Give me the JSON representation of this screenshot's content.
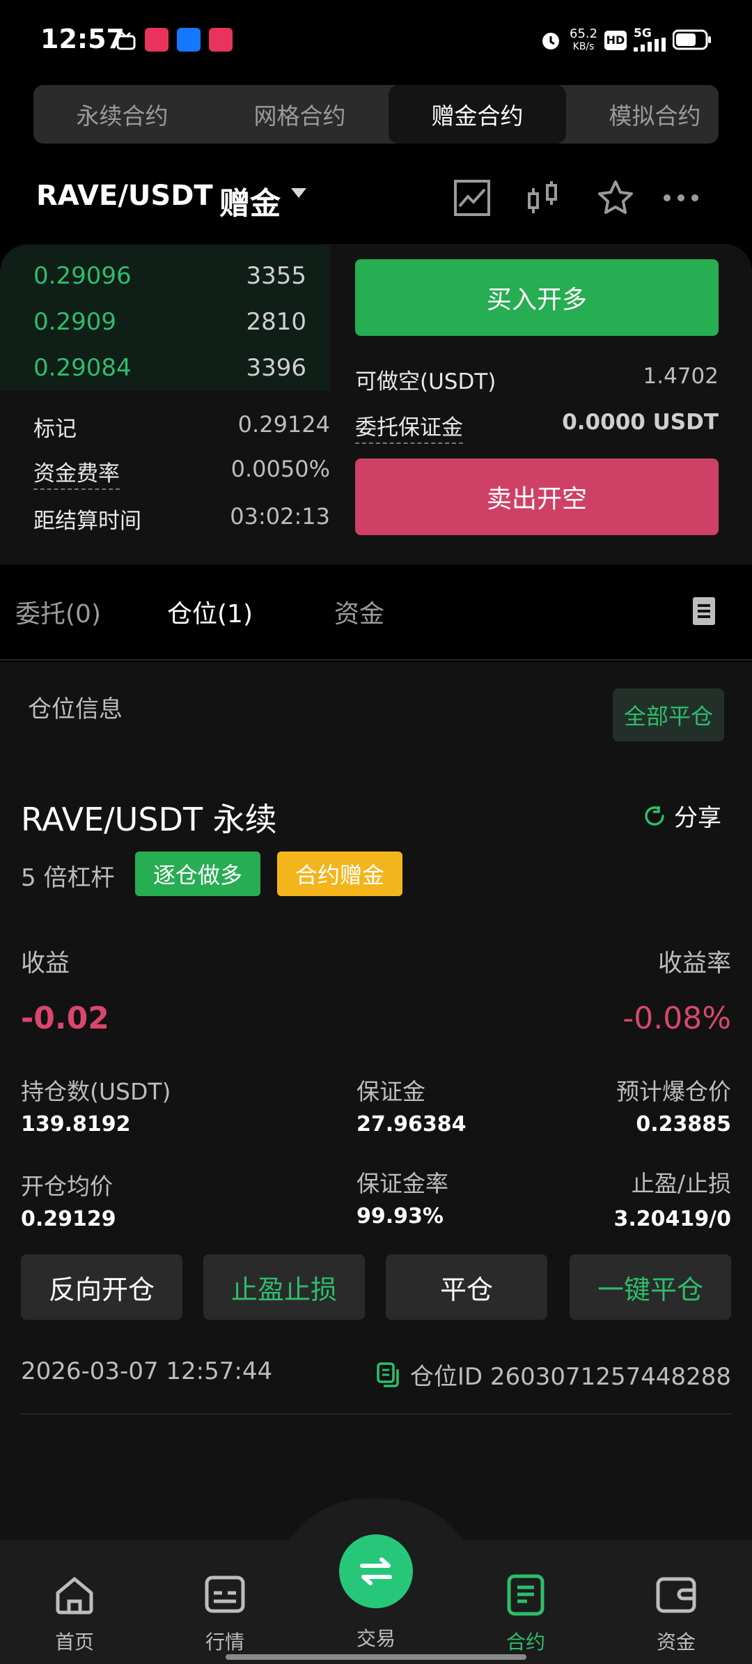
{
  "status_bar": {
    "time": "12:57",
    "net_speed": "65.2",
    "net_unit": "KB/s",
    "hd": "HD",
    "signal": "5G"
  },
  "top_tabs": [
    "永续合约",
    "网格合约",
    "赠金合约",
    "模拟合约"
  ],
  "pair": {
    "symbol": "RAVE/USDT",
    "badge": "赠金"
  },
  "orderbook": [
    {
      "price": "0.29096",
      "qty": "3355"
    },
    {
      "price": "0.2909",
      "qty": "2810"
    },
    {
      "price": "0.29084",
      "qty": "3396"
    }
  ],
  "market_info": {
    "mark_label": "标记",
    "mark_value": "0.29124",
    "funding_label": "资金费率",
    "funding_value": "0.0050%",
    "settle_label": "距结算时间",
    "settle_value": "03:02:13"
  },
  "order_panel": {
    "buy_label": "买入开多",
    "sell_label": "卖出开空",
    "avail_label": "可做空(USDT)",
    "avail_value": "1.4702",
    "margin_label": "委托保证金",
    "margin_value": "0.0000 USDT"
  },
  "sub_tabs": [
    "委托(0)",
    "仓位(1)",
    "资金"
  ],
  "positions": {
    "section_title": "仓位信息",
    "close_all": "全部平仓",
    "contract": "RAVE/USDT 永续",
    "share": "分享",
    "leverage": "5 倍杠杆",
    "tag_mode": "逐仓做多",
    "tag_bonus": "合约赠金",
    "pnl_label": "收益",
    "pnl_value": "-0.02",
    "pnl_rate_label": "收益率",
    "pnl_rate_value": "-0.08%",
    "size_label": "持仓数(USDT)",
    "size_value": "139.8192",
    "margin_label": "保证金",
    "margin_value": "27.96384",
    "liq_label": "预计爆仓价",
    "liq_value": "0.23885",
    "entry_label": "开仓均价",
    "entry_value": "0.29129",
    "mrate_label": "保证金率",
    "mrate_value": "99.93%",
    "tpsl_label": "止盈/止损",
    "tpsl_value": "3.20419/0",
    "actions": [
      "反向开仓",
      "止盈止损",
      "平仓",
      "一键平仓"
    ],
    "timestamp": "2026-03-07 12:57:44",
    "position_id": "仓位ID 2603071257448288"
  },
  "bottom_nav": [
    "首页",
    "行情",
    "交易",
    "合约",
    "资金"
  ],
  "colors": {
    "green": "#27ad52",
    "red": "#cf4067",
    "yellow": "#f3b51b",
    "accent": "#2ebd6b"
  }
}
